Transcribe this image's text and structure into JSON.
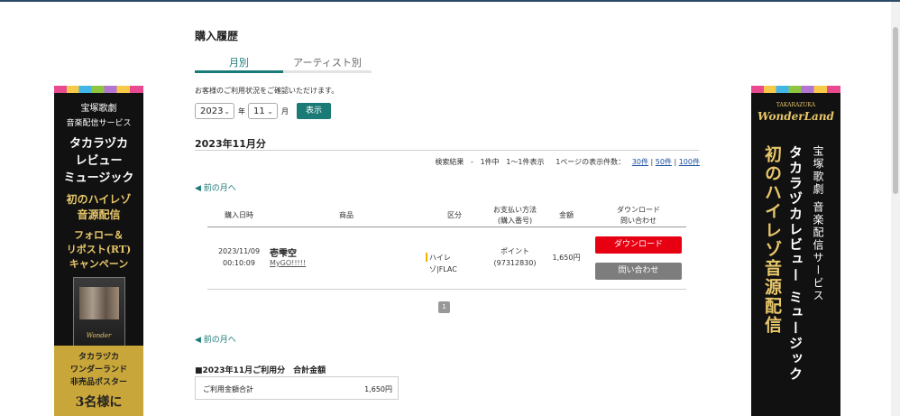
{
  "page": {
    "title": "購入履歴",
    "tabs": [
      "月別",
      "アーティスト別"
    ],
    "intro": "お客様のご利用状況をご確認いただけます。"
  },
  "filter": {
    "year": "2023",
    "year_unit": "年",
    "month": "11",
    "month_unit": "月",
    "show_label": "表示"
  },
  "section": {
    "title": "2023年11月分",
    "results_label": "検索結果",
    "results_dash": "-",
    "results_count": "1件中",
    "results_range": "1〜1件表示",
    "per_page_label": "1ページの表示件数：",
    "per_page_options": [
      "30件",
      "50件",
      "100件"
    ],
    "prev_month": "◀ 前の月へ"
  },
  "table": {
    "headers": {
      "date": "購入日時",
      "product": "商品",
      "type": "区分",
      "payment_1": "お支払い方法",
      "payment_2": "(購入番号)",
      "amount": "金額",
      "download_1": "ダウンロード",
      "download_2": "問い合わせ"
    },
    "rows": [
      {
        "date": "2023/11/09",
        "time": "00:10:09",
        "title": "壱雫空",
        "artist": "MyGO!!!!!",
        "type": "ハイレゾ|FLAC",
        "payment": "ポイント",
        "order_no": "(97312830)",
        "amount": "1,650円",
        "download_label": "ダウンロード",
        "inquiry_label": "問い合わせ"
      }
    ]
  },
  "pager": {
    "current": "1"
  },
  "total": {
    "title": "■2023年11月ご利用分　合計金額",
    "label": "ご利用金額合計",
    "value": "1,650円"
  },
  "banner_left": {
    "line1": "宝塚歌劇",
    "line2": "音楽配信サービス",
    "line3a": "タカラヅカ",
    "line3b": "レビュー",
    "line3c": "ミュージック",
    "line4a": "初のハイレゾ",
    "line4b": "音源配信",
    "line5a": "フォロー＆",
    "line5b": "リポスト(RT)",
    "line5c": "キャンペーン",
    "gold1": "タカラヅカ",
    "gold2": "ワンダーランド",
    "gold3": "非売品ポスター",
    "gold4": "3名様に"
  },
  "banner_right": {
    "logo_top": "TAKARAZUKA",
    "logo": "WonderLand",
    "col1": "宝塚歌劇 音楽配信サービス",
    "col2": "タカラヅカレビュー ミュージック",
    "col3": "初のハイレゾ音源配信"
  },
  "colors": {
    "accent": "#1a7a76",
    "download": "#e60012",
    "inquiry": "#7d7d7d",
    "link": "#1a4fa0"
  }
}
